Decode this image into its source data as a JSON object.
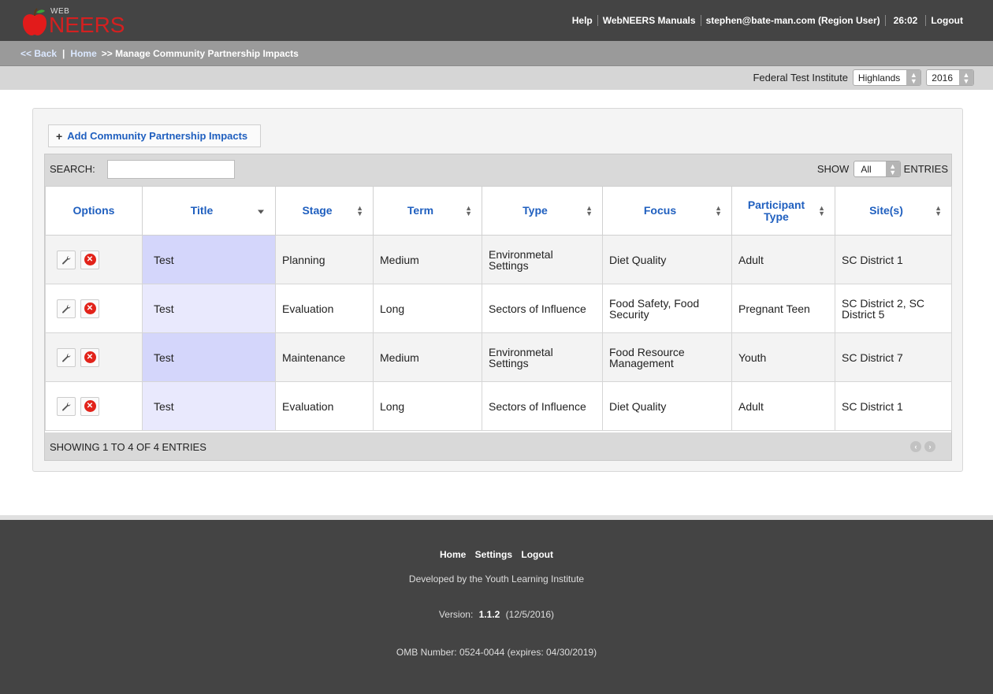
{
  "header": {
    "logo_small": "WEB",
    "logo_big": "NEERS",
    "nav": [
      "Help",
      "WebNEERS Manuals",
      "stephen@bate-man.com (Region User)",
      "26:02",
      "Logout"
    ]
  },
  "breadcrumb": {
    "back": "<< Back",
    "home": "Home",
    "current": ">> Manage Community Partnership Impacts"
  },
  "filters": {
    "institute": "Federal Test Institute",
    "region": "Highlands",
    "year": "2016"
  },
  "toolbar": {
    "add_label": "Add Community Partnership Impacts",
    "search_label": "SEARCH:",
    "search_value": "",
    "show_label": "SHOW",
    "show_value": "All",
    "entries_label": "ENTRIES"
  },
  "table": {
    "columns": [
      "Options",
      "Title",
      "Stage",
      "Term",
      "Type",
      "Focus",
      "Participant Type",
      "Site(s)"
    ],
    "rows": [
      {
        "title": "Test",
        "stage": "Planning",
        "term": "Medium",
        "type": "Environmetal Settings",
        "focus": "Diet Quality",
        "participant": "Adult",
        "sites": "SC District 1"
      },
      {
        "title": "Test",
        "stage": "Evaluation",
        "term": "Long",
        "type": "Sectors of Influence",
        "focus": "Food Safety, Food Security",
        "participant": "Pregnant Teen",
        "sites": "SC District 2, SC District 5"
      },
      {
        "title": "Test",
        "stage": "Maintenance",
        "term": "Medium",
        "type": "Environmetal Settings",
        "focus": "Food Resource Management",
        "participant": "Youth",
        "sites": "SC District 7"
      },
      {
        "title": "Test",
        "stage": "Evaluation",
        "term": "Long",
        "type": "Sectors of Influence",
        "focus": "Diet Quality",
        "participant": "Adult",
        "sites": "SC District 1"
      }
    ],
    "info": "SHOWING 1 TO 4 OF 4 ENTRIES"
  },
  "footer": {
    "links": [
      "Home",
      "Settings",
      "Logout"
    ],
    "developed": "Developed by the Youth Learning Institute",
    "version_label": "Version:",
    "version": "1.1.2",
    "version_date": "(12/5/2016)",
    "omb": "OMB Number: 0524-0044 (expires: 04/30/2019)"
  },
  "colors": {
    "header_bg": "#444444",
    "link_blue": "#1f5fbf",
    "title_highlight": "#d4d6fb",
    "delete_red": "#e2231a"
  }
}
